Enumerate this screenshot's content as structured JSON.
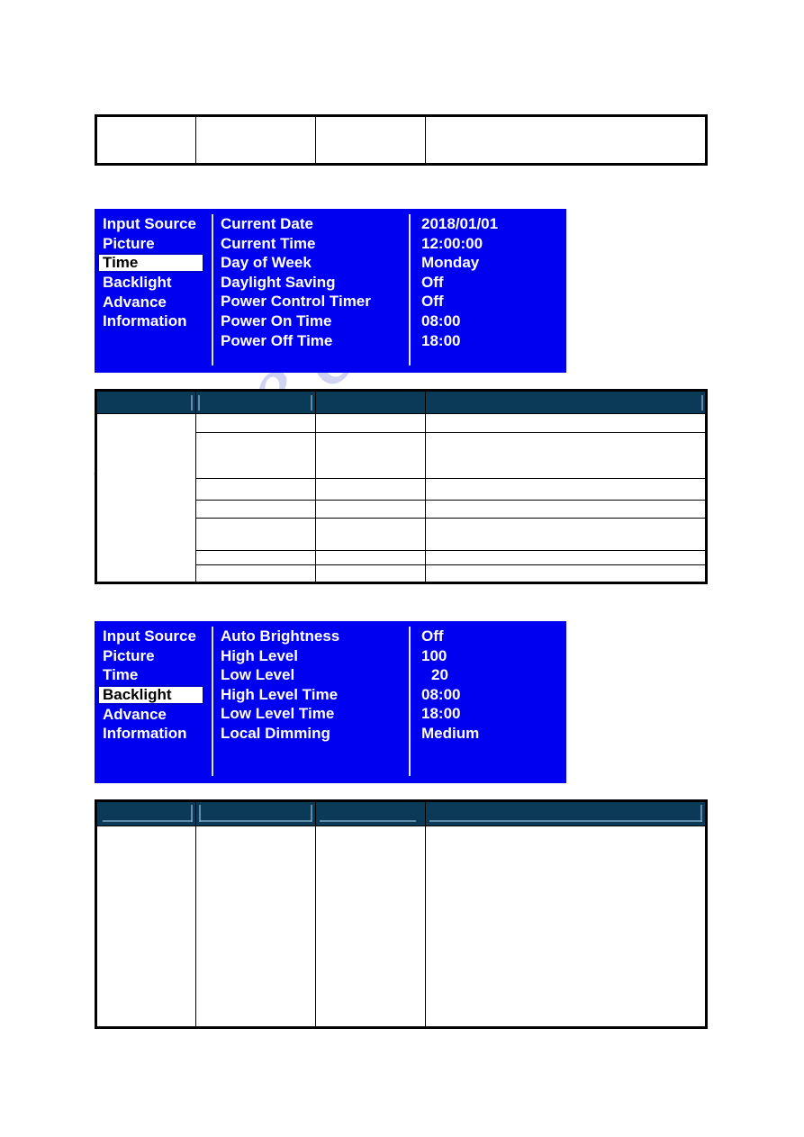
{
  "page": {
    "watermark": "lshive.com",
    "watermark_color": "#ccd0f0",
    "background": "#ffffff"
  },
  "colors": {
    "osd_background": "#0000f0",
    "osd_text": "#ffffff",
    "osd_selected_bg": "#ffffff",
    "osd_selected_text": "#000000",
    "osd_selected_border": "#0000cd",
    "osd_divider": "#e2e2ea",
    "table_header_bg": "#0b3a58",
    "table_header_mark": "#7ea8c4",
    "table_border": "#000000"
  },
  "tables": {
    "top": {
      "name": "top-empty-table",
      "columns": 4,
      "rows": [
        [
          "",
          "",
          "",
          ""
        ]
      ]
    },
    "middle": {
      "name": "time-menu-description-table",
      "header": [
        "",
        "",
        "",
        ""
      ],
      "rows": [
        [
          "",
          "",
          "",
          ""
        ],
        [
          "",
          "",
          "",
          ""
        ],
        [
          "",
          "",
          "",
          ""
        ],
        [
          "",
          "",
          "",
          ""
        ],
        [
          "",
          "",
          "",
          ""
        ],
        [
          "",
          "",
          "",
          ""
        ],
        [
          "",
          "",
          "",
          ""
        ]
      ]
    },
    "bottom": {
      "name": "backlight-menu-description-table",
      "header": [
        "",
        "",
        "",
        ""
      ],
      "rows": [
        [
          "",
          "",
          "",
          ""
        ]
      ]
    }
  },
  "osd_time_menu": {
    "name": "time-osd-menu",
    "sidebar": [
      {
        "label": "Input Source",
        "selected": false
      },
      {
        "label": "Picture",
        "selected": false
      },
      {
        "label": "Time",
        "selected": true
      },
      {
        "label": "Backlight",
        "selected": false
      },
      {
        "label": "Advance",
        "selected": false
      },
      {
        "label": "Information",
        "selected": false
      }
    ],
    "items": [
      {
        "label": "Current Date",
        "value": "2018/01/01",
        "indent": false
      },
      {
        "label": "Current Time",
        "value": "12:00:00",
        "indent": false
      },
      {
        "label": "Day of Week",
        "value": "Monday",
        "indent": false
      },
      {
        "label": "Daylight Saving",
        "value": "Off",
        "indent": false
      },
      {
        "label": "Power Control Timer",
        "value": "Off",
        "indent": false
      },
      {
        "label": "Power On Time",
        "value": "08:00",
        "indent": false
      },
      {
        "label": "Power Off Time",
        "value": "18:00",
        "indent": false
      }
    ]
  },
  "osd_backlight_menu": {
    "name": "backlight-osd-menu",
    "sidebar": [
      {
        "label": "Input Source",
        "selected": false
      },
      {
        "label": "Picture",
        "selected": false
      },
      {
        "label": "Time",
        "selected": false
      },
      {
        "label": "Backlight",
        "selected": true
      },
      {
        "label": "Advance",
        "selected": false
      },
      {
        "label": "Information",
        "selected": false
      }
    ],
    "items": [
      {
        "label": "Auto Brightness",
        "value": "Off",
        "indent": false
      },
      {
        "label": "High Level",
        "value": "100",
        "indent": false
      },
      {
        "label": "Low Level",
        "value": "20",
        "indent": true
      },
      {
        "label": "High Level Time",
        "value": "08:00",
        "indent": false
      },
      {
        "label": "Low Level Time",
        "value": "18:00",
        "indent": false
      },
      {
        "label": "Local Dimming",
        "value": "Medium",
        "indent": false
      }
    ]
  }
}
